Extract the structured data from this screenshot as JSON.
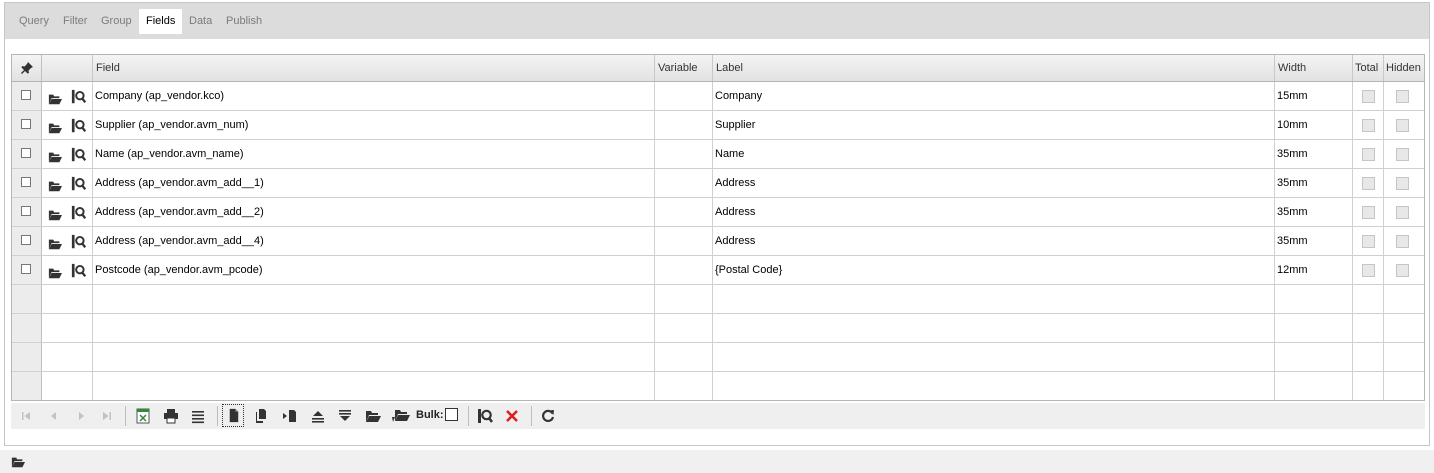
{
  "tabs": [
    "Query",
    "Filter",
    "Group",
    "Fields",
    "Data",
    "Publish"
  ],
  "active_tab": "Fields",
  "columns": {
    "pin": "pin-icon",
    "field": "Field",
    "variable": "Variable",
    "label": "Label",
    "width": "Width",
    "total": "Total",
    "hidden": "Hidden"
  },
  "rows": [
    {
      "field": "Company (ap_vendor.kco)",
      "variable": "",
      "label": "Company",
      "width": "15mm"
    },
    {
      "field": "Supplier (ap_vendor.avm_num)",
      "variable": "",
      "label": "Supplier",
      "width": "10mm"
    },
    {
      "field": "Name (ap_vendor.avm_name)",
      "variable": "",
      "label": "Name",
      "width": "35mm"
    },
    {
      "field": "Address (ap_vendor.avm_add__1)",
      "variable": "",
      "label": "Address",
      "width": "35mm"
    },
    {
      "field": "Address (ap_vendor.avm_add__2)",
      "variable": "",
      "label": "Address",
      "width": "35mm"
    },
    {
      "field": "Address (ap_vendor.avm_add__4)",
      "variable": "",
      "label": "Address",
      "width": "35mm"
    },
    {
      "field": "Postcode (ap_vendor.avm_pcode)",
      "variable": "",
      "label": "{Postal Code}",
      "width": "12mm"
    }
  ],
  "toolbar": {
    "bulk_label": "Bulk:"
  },
  "colors": {
    "tab_bar": "#dcdcdc",
    "delete_red": "#e02020",
    "excel_green": "#2e8b3a"
  }
}
